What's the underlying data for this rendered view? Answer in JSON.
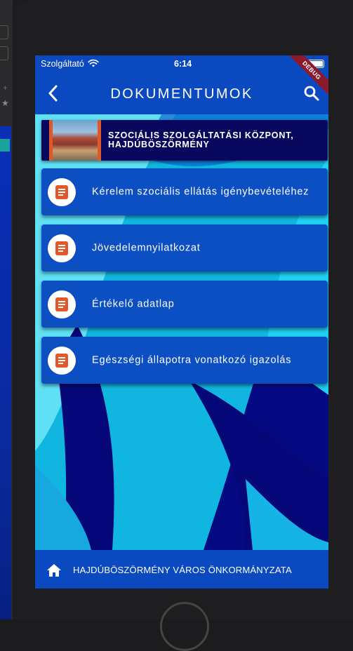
{
  "status_bar": {
    "carrier": "Szolgáltató",
    "time": "6:14",
    "debug_banner": "DEBUG"
  },
  "app_bar": {
    "title": "DOKUMENTUMOK",
    "back_icon": "chevron-left-icon",
    "search_icon": "search-icon"
  },
  "header": {
    "title": "SZOCIÁLIS SZOLGÁLTATÁSI KÖZPONT, HAJDÚBÖSZÖRMÉNY"
  },
  "documents": [
    {
      "label": "Kérelem szociális ellátás igénybevételéhez",
      "icon": "document-icon"
    },
    {
      "label": "Jövedelemnyilatkozat",
      "icon": "document-icon"
    },
    {
      "label": "Értékelő adatlap",
      "icon": "document-icon"
    },
    {
      "label": "Egészségi állapotra vonatkozó igazolás",
      "icon": "document-icon"
    }
  ],
  "bottom_bar": {
    "label": "HAJDÚBÖSZÖRMÉNY VÁROS ÖNKORMÁNYZATA",
    "icon": "home-icon"
  },
  "colors": {
    "primary": "#0b49c0",
    "header_card": "#07075e",
    "doc_icon": "#e0572a",
    "debug_ribbon": "#8b1b2c"
  }
}
